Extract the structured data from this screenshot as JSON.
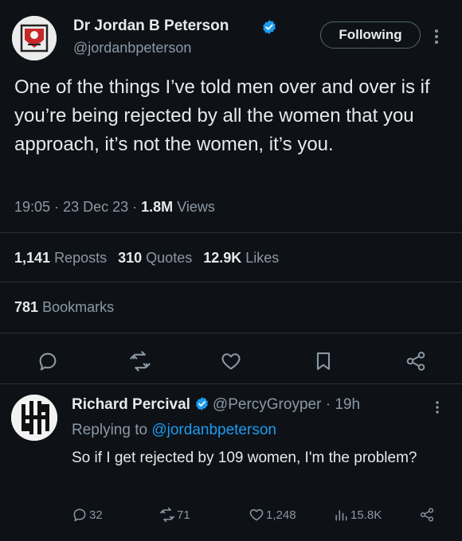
{
  "main_tweet": {
    "author": {
      "name": "Dr Jordan B Peterson",
      "handle": "@jordanbpeterson",
      "verified": true
    },
    "follow_button_label": "Following",
    "text": "One of the things I’ve told men over and over is if you’re being rejected by all the women that you approach, it’s not the women, it’s you.",
    "time": "19:05",
    "date": "23 Dec 23",
    "views_count": "1.8M",
    "views_label": "Views",
    "stats": {
      "reposts_count": "1,141",
      "reposts_label": "Reposts",
      "quotes_count": "310",
      "quotes_label": "Quotes",
      "likes_count": "12.9K",
      "likes_label": "Likes",
      "bookmarks_count": "781",
      "bookmarks_label": "Bookmarks"
    },
    "actions": [
      "reply-icon",
      "repost-icon",
      "like-icon",
      "bookmark-icon",
      "share-icon"
    ]
  },
  "reply": {
    "author": {
      "name": "Richard Percival",
      "handle": "@PercyGroyper",
      "verified": true
    },
    "time_ago": "19h",
    "replying_to_label": "Replying to",
    "replying_to_handle": "@jordanbpeterson",
    "text": "So if I get rejected by 109 women, I'm the problem?",
    "counts": {
      "replies": "32",
      "reposts": "71",
      "likes": "1,248",
      "views": "15.8K"
    }
  },
  "colors": {
    "background": "#0e1217",
    "text": "#e7e9ea",
    "muted": "#8b98a5",
    "accent": "#1d9bf0",
    "divider": "#2f3336"
  }
}
